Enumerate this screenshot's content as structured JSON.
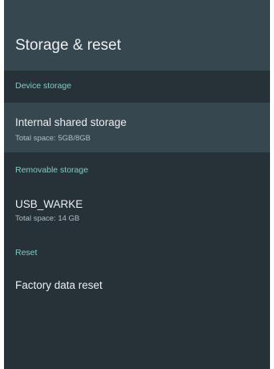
{
  "header": {
    "title": "Storage & reset"
  },
  "sections": [
    {
      "header": "Device storage",
      "items": [
        {
          "title": "Internal shared storage",
          "summary": "Total space: 5GB/8GB",
          "focused": true
        }
      ]
    },
    {
      "header": "Removable storage",
      "items": [
        {
          "title": "USB_WARKE",
          "summary": "Total space: 14 GB",
          "focused": false
        }
      ]
    },
    {
      "header": "Reset",
      "items": [
        {
          "title": "Factory data reset",
          "focused": false
        }
      ]
    }
  ],
  "colors": {
    "background": "#263238",
    "header_background": "#37474f",
    "focused_item_background": "#37474f",
    "section_header_text": "#80cbc4",
    "primary_text": "#eceff1",
    "secondary_text": "#b0bec5"
  }
}
